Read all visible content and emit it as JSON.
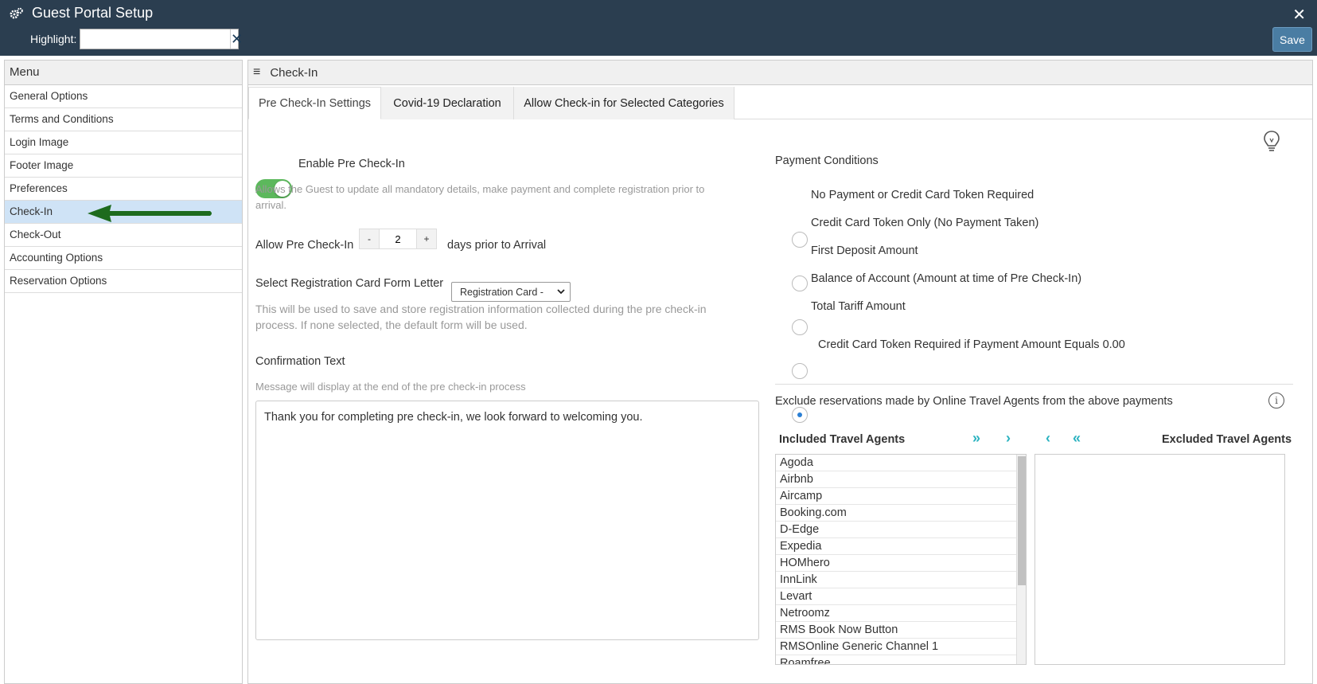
{
  "header": {
    "title": "Guest Portal Setup",
    "highlight_label": "Highlight:",
    "highlight_value": "",
    "save_label": "Save"
  },
  "menu": {
    "title": "Menu",
    "items": [
      {
        "label": "General Options"
      },
      {
        "label": "Terms and Conditions"
      },
      {
        "label": "Login Image"
      },
      {
        "label": "Footer Image"
      },
      {
        "label": "Preferences"
      },
      {
        "label": "Check-In"
      },
      {
        "label": "Check-Out"
      },
      {
        "label": "Accounting Options"
      },
      {
        "label": "Reservation Options"
      }
    ],
    "active": "Check-In"
  },
  "main": {
    "section_title": "Check-In",
    "tabs": [
      {
        "label": "Pre Check-In Settings"
      },
      {
        "label": "Covid-19 Declaration"
      },
      {
        "label": "Allow Check-in for Selected Categories"
      }
    ]
  },
  "pre_checkin": {
    "enable_label": "Enable Pre Check-In",
    "enable_on": true,
    "enable_help": "Allows the Guest to update all mandatory details, make payment and complete registration prior to arrival.",
    "allow_label": "Allow Pre Check-In",
    "minus": "-",
    "plus": "+",
    "days_value": "2",
    "days_suffix": "days prior to Arrival",
    "reg_card_label": "Select Registration Card Form Letter",
    "reg_card_value": "Registration Card -",
    "reg_card_help": "This will be used to save and store registration information collected during the pre check-in process. If none selected, the default form will be used.",
    "confirmation_label": "Confirmation Text",
    "confirmation_help": "Message will display at the end of the pre check-in process",
    "confirmation_text": "Thank you for completing pre check-in, we look forward to welcoming you."
  },
  "payment": {
    "title": "Payment Conditions",
    "options": [
      {
        "label": "No Payment or Credit Card Token Required",
        "checked": false
      },
      {
        "label": "Credit Card Token Only (No Payment Taken)",
        "checked": false
      },
      {
        "label": "First Deposit Amount",
        "checked": false
      },
      {
        "label": "Balance of Account (Amount at time of Pre Check-In)",
        "checked": false
      },
      {
        "label": "Total Tariff Amount",
        "checked": true
      }
    ],
    "token_zero_label": "Credit Card Token Required if Payment Amount Equals 0.00",
    "token_zero_on": false,
    "exclude_label": "Exclude reservations made by Online Travel Agents from the above payments"
  },
  "agents": {
    "included_title": "Included Travel Agents",
    "excluded_title": "Excluded Travel Agents",
    "included": [
      "Agoda",
      "Airbnb",
      "Aircamp",
      "Booking.com",
      "D-Edge",
      "Expedia",
      "HOMhero",
      "InnLink",
      "Levart",
      "Netroomz",
      "RMS Book Now Button",
      "RMSOnline Generic Channel 1",
      "Roamfree"
    ],
    "excluded": []
  },
  "colors": {
    "header_bg": "#2b3e50",
    "active_menu_bg": "#cfe3f6",
    "toggle_on": "#5cb85c",
    "arrow_green": "#1e6b1e",
    "teal_arrows": "#2bb3c0"
  }
}
